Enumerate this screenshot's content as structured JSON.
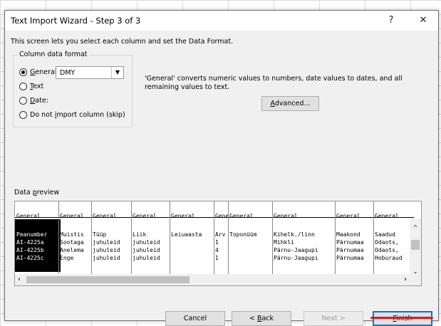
{
  "window": {
    "title": "Text Import Wizard - Step 3 of 3",
    "help_glyph": "?",
    "close_glyph": "✕"
  },
  "intro": "This screen lets you select each column and set the Data Format.",
  "format_group": {
    "label": "Column data format",
    "general": {
      "prefix": "",
      "hotkey": "G",
      "rest": "eneral",
      "selected": true
    },
    "text": {
      "hotkey": "T",
      "rest": "ext",
      "selected": false
    },
    "date": {
      "hotkey": "D",
      "rest": "ate:",
      "selected": false,
      "value": "DMY"
    },
    "skip": {
      "before": "Do not ",
      "hotkey": "i",
      "after": "mport column (skip)",
      "selected": false
    }
  },
  "description": "'General' converts numeric values to numbers, date values to dates, and all remaining values to text.",
  "advanced_button": {
    "hotkey": "A",
    "rest": "dvanced..."
  },
  "preview": {
    "label_hotkey": "p",
    "label_before": "Data ",
    "label_after": "review",
    "headers": [
      "General",
      "General",
      "General",
      "General",
      "General",
      "General",
      "General",
      "General",
      "General",
      "General"
    ],
    "rows": [
      [
        "Peanumber",
        "Muistis",
        "Tüüp",
        "Liik",
        "Leiuaasta",
        "Arv",
        "Toponüüm",
        "Kihelk./linn",
        "Maakond",
        "Saadud"
      ],
      [
        "AI-4225a",
        "Sootaga",
        "juhuleid",
        "juhuleid",
        "",
        "1",
        "",
        "Mihkli",
        "Pärnumaa",
        "Odaots,"
      ],
      [
        "AI-4225b",
        "Anelema",
        "juhuleid",
        "juhuleid",
        "",
        "4",
        "",
        "Pärnu-Jaagupi",
        "Pärnumaa",
        "Odaots,"
      ],
      [
        "AI-4225c",
        "Enge",
        "juhuleid",
        "juhuleid",
        "",
        "1",
        "",
        "Pärnu-Jaagupi",
        "Pärnumaa",
        "Hoburaud"
      ]
    ]
  },
  "buttons": {
    "cancel": "Cancel",
    "back": {
      "before": "< ",
      "hotkey": "B",
      "rest": "ack"
    },
    "next": "Next >",
    "finish": {
      "hotkey": "F",
      "rest": "inish"
    }
  }
}
